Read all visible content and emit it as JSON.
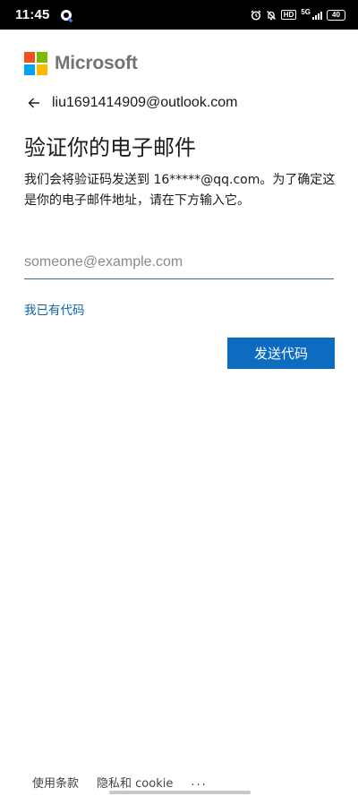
{
  "status_bar": {
    "time": "11:45",
    "hd_badge": "HD",
    "network": "5G",
    "battery": "40"
  },
  "brand": {
    "name": "Microsoft",
    "logo_colors": [
      "#F25022",
      "#7FBA00",
      "#00A4EF",
      "#FFB900"
    ]
  },
  "identity": {
    "email": "liu1691414909@outlook.com"
  },
  "page": {
    "title": "验证你的电子邮件",
    "description": "我们会将验证码发送到 16*****@qq.com。为了确定这是你的电子邮件地址，请在下方输入它。"
  },
  "form": {
    "email_value": "",
    "email_placeholder": "someone@example.com",
    "have_code_link": "我已有代码",
    "send_button": "发送代码"
  },
  "footer": {
    "terms": "使用条款",
    "privacy": "隐私和 cookie",
    "more": "..."
  },
  "colors": {
    "accent": "#0E6CC0",
    "link": "#0B63A6"
  }
}
